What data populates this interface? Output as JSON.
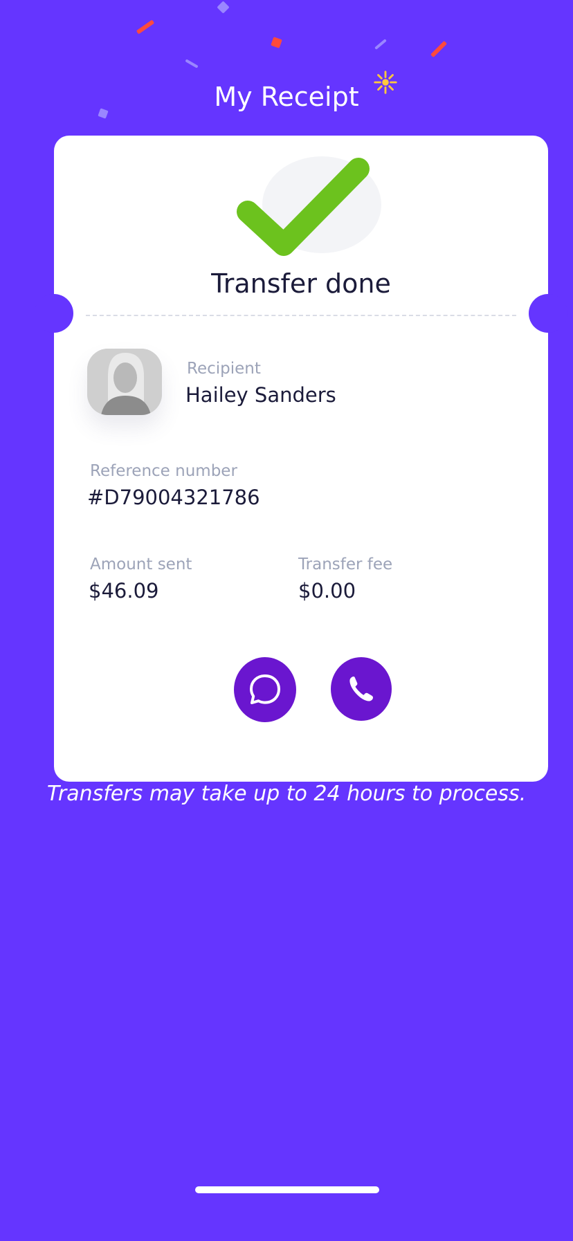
{
  "header": {
    "title": "My Receipt"
  },
  "receipt": {
    "status_title": "Transfer done",
    "recipient_label": "Recipient",
    "recipient_name": "Hailey Sanders",
    "reference_label": "Reference number",
    "reference_value": "#D79004321786",
    "amount_label": "Amount sent",
    "amount_value": "$46.09",
    "fee_label": "Transfer fee",
    "fee_value": "$0.00"
  },
  "actions": {
    "message_icon": "chat-bubble-icon",
    "call_icon": "phone-icon"
  },
  "footer": {
    "note": "Transfers may take up to 24 hours to process."
  },
  "colors": {
    "background": "#6535FF",
    "card": "#FFFFFF",
    "success": "#6CC21E",
    "action_button": "#6A16CF",
    "label_text": "#9CA3B8",
    "value_text": "#1B1B3A"
  }
}
